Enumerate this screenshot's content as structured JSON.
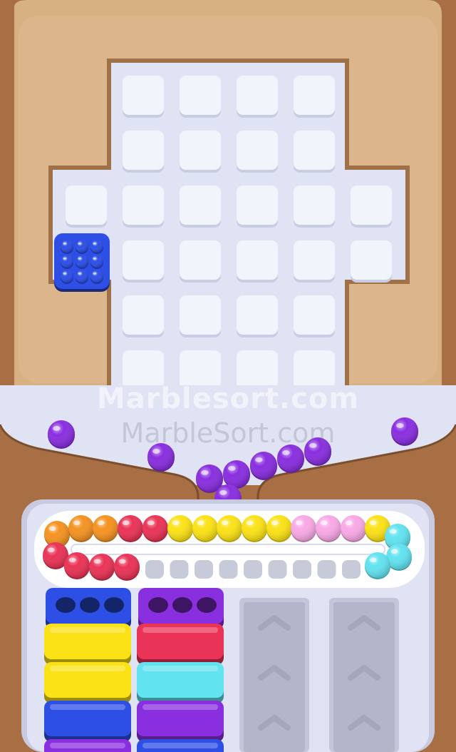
{
  "watermark": {
    "primary": "Marblesort.com",
    "secondary": "MarbleSort.com"
  },
  "colors": {
    "wood_dark": "#a86f45",
    "wood_light": "#d8b183",
    "board": "#dfe3f3",
    "tile": "#f2f4fb",
    "blue": "#2d4fe6",
    "purple": "#8a2fe0",
    "yellow": "#fbe217",
    "orange": "#f59322",
    "red": "#ea3457",
    "pink": "#f9a9e6",
    "cyan": "#62e3f0"
  },
  "board": {
    "tile_rows": [
      {
        "row": 1,
        "cols": [
          2,
          3,
          4,
          5
        ]
      },
      {
        "row": 2,
        "cols": [
          2,
          3,
          4,
          5
        ]
      },
      {
        "row": 3,
        "cols": [
          1,
          2,
          3,
          4,
          5,
          6
        ]
      },
      {
        "row": 4,
        "cols": [
          1,
          2,
          3,
          4,
          5,
          6
        ]
      },
      {
        "row": 5,
        "cols": [
          2,
          3,
          4,
          5
        ]
      },
      {
        "row": 6,
        "cols": [
          2,
          3,
          4,
          5
        ]
      }
    ],
    "placed_blocks": [
      {
        "color": "blue",
        "row": 4,
        "col": 1,
        "balls": 9
      }
    ]
  },
  "funnel_marbles": [
    "purple",
    "purple",
    "purple",
    "purple",
    "purple",
    "purple",
    "purple",
    "purple",
    "purple",
    "purple"
  ],
  "conveyor": {
    "top_row": [
      "orange",
      "orange",
      "orange",
      "red",
      "red",
      "yellow",
      "yellow",
      "yellow",
      "yellow",
      "yellow",
      "pink",
      "pink",
      "pink",
      "yellow",
      "cyan"
    ],
    "bottom_row": [
      "red",
      "red",
      "red",
      "red"
    ],
    "right_end": [
      "cyan",
      "cyan"
    ],
    "empty_slots": 9
  },
  "holders": [
    {
      "name": "holder-1",
      "cups": [
        "blue"
      ],
      "stack": [
        "yellow",
        "yellow",
        "blue",
        "purple"
      ]
    },
    {
      "name": "holder-2",
      "cups": [
        "purple"
      ],
      "stack": [
        "red",
        "cyan",
        "purple",
        "blue"
      ]
    },
    {
      "name": "holder-3",
      "locked": true
    },
    {
      "name": "holder-4",
      "locked": true
    }
  ]
}
